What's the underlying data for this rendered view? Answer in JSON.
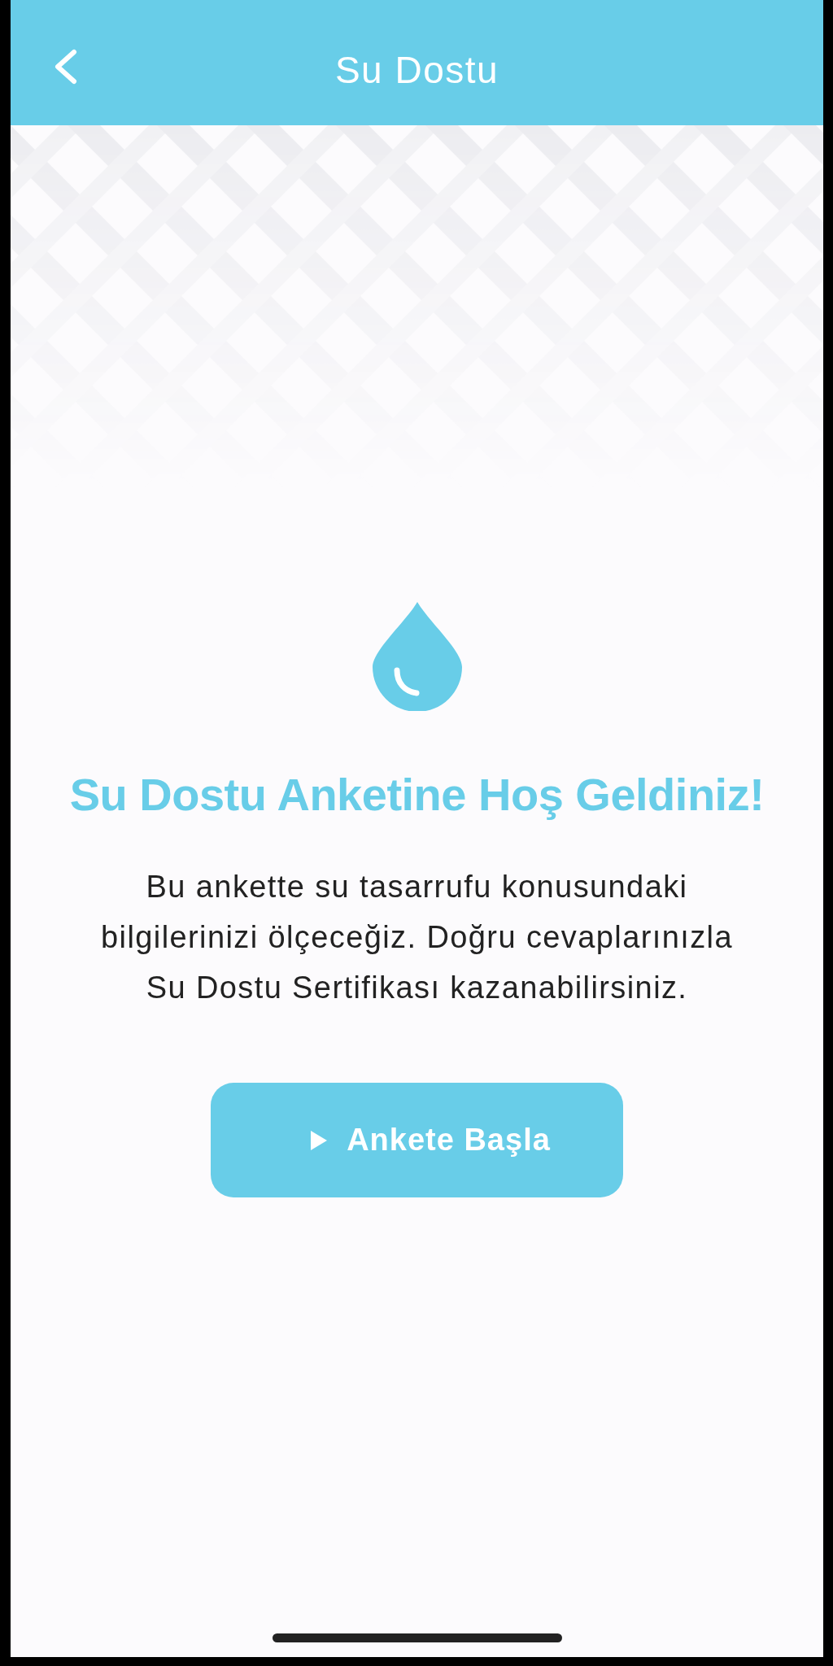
{
  "header": {
    "title": "Su Dostu"
  },
  "welcome": {
    "heading": "Su Dostu Anketine Hoş Geldiniz!",
    "text": "Bu ankette su tasarrufu konusundaki\nbilgilerinizi ölçeceğiz. Doğru cevaplarınızla\nSu Dostu Sertifikası kazanabilirsiniz."
  },
  "start_button": {
    "label": "Ankete Başla"
  }
}
